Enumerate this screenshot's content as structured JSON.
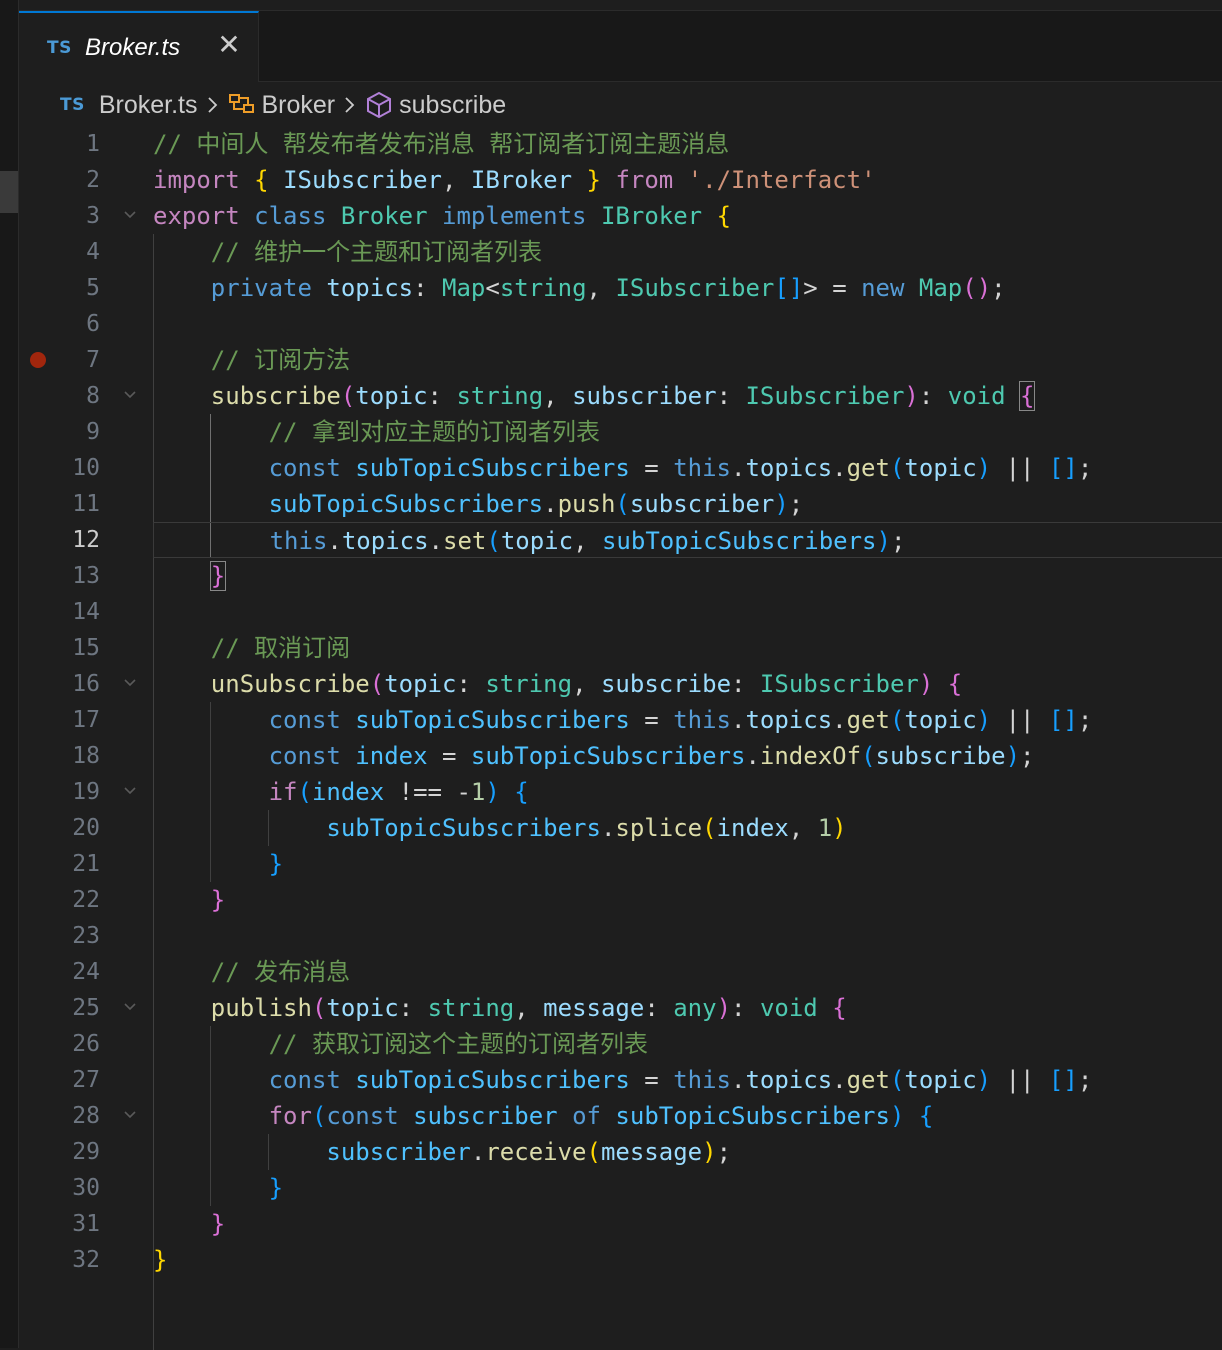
{
  "tab": {
    "lang_badge": "TS",
    "filename": "Broker.ts",
    "close_glyph": "✕"
  },
  "breadcrumb": {
    "lang_badge": "TS",
    "file": "Broker.ts",
    "class_name": "Broker",
    "method_name": "subscribe",
    "class_icon": "symbol-class-icon",
    "method_icon": "symbol-method-icon"
  },
  "editor": {
    "current_line": 12,
    "breakpoint_line": 7,
    "lines": [
      [
        [
          "cm",
          "// 中间人 帮发布者发布消息 帮订阅者订阅主题消息"
        ]
      ],
      [
        [
          "kc",
          "import"
        ],
        [
          "pu",
          " "
        ],
        [
          "b1",
          "{"
        ],
        [
          "pu",
          " "
        ],
        [
          "va",
          "ISubscriber"
        ],
        [
          "pu",
          ", "
        ],
        [
          "va",
          "IBroker"
        ],
        [
          "pu",
          " "
        ],
        [
          "b1",
          "}"
        ],
        [
          "pu",
          " "
        ],
        [
          "kc",
          "from"
        ],
        [
          "pu",
          " "
        ],
        [
          "st",
          "'./Interfact'"
        ]
      ],
      [
        [
          "kc",
          "export"
        ],
        [
          "pu",
          " "
        ],
        [
          "kw",
          "class"
        ],
        [
          "pu",
          " "
        ],
        [
          "ty",
          "Broker"
        ],
        [
          "pu",
          " "
        ],
        [
          "kw",
          "implements"
        ],
        [
          "pu",
          " "
        ],
        [
          "ty",
          "IBroker"
        ],
        [
          "pu",
          " "
        ],
        [
          "b1",
          "{"
        ]
      ],
      [
        [
          "pu",
          "    "
        ],
        [
          "cm",
          "// 维护一个主题和订阅者列表"
        ]
      ],
      [
        [
          "pu",
          "    "
        ],
        [
          "kw",
          "private"
        ],
        [
          "pu",
          " "
        ],
        [
          "va",
          "topics"
        ],
        [
          "pu",
          ": "
        ],
        [
          "ty",
          "Map"
        ],
        [
          "pu",
          "<"
        ],
        [
          "ty",
          "string"
        ],
        [
          "pu",
          ", "
        ],
        [
          "ty",
          "ISubscriber"
        ],
        [
          "b3",
          "[]"
        ],
        [
          "pu",
          "> = "
        ],
        [
          "kw",
          "new"
        ],
        [
          "pu",
          " "
        ],
        [
          "ty",
          "Map"
        ],
        [
          "b2",
          "()"
        ],
        [
          "pu",
          ";"
        ]
      ],
      [
        [
          "pu",
          ""
        ]
      ],
      [
        [
          "pu",
          "    "
        ],
        [
          "cm",
          "// 订阅方法"
        ]
      ],
      [
        [
          "pu",
          "    "
        ],
        [
          "fn",
          "subscribe"
        ],
        [
          "b2",
          "("
        ],
        [
          "va",
          "topic"
        ],
        [
          "pu",
          ": "
        ],
        [
          "ty",
          "string"
        ],
        [
          "pu",
          ", "
        ],
        [
          "va",
          "subscriber"
        ],
        [
          "pu",
          ": "
        ],
        [
          "ty",
          "ISubscriber"
        ],
        [
          "b2",
          ")"
        ],
        [
          "pu",
          ": "
        ],
        [
          "ty",
          "void"
        ],
        [
          "pu",
          " "
        ],
        [
          "b2m",
          "{"
        ]
      ],
      [
        [
          "pu",
          "        "
        ],
        [
          "cm",
          "// 拿到对应主题的订阅者列表"
        ]
      ],
      [
        [
          "pu",
          "        "
        ],
        [
          "kw",
          "const"
        ],
        [
          "pu",
          " "
        ],
        [
          "co",
          "subTopicSubscribers"
        ],
        [
          "pu",
          " = "
        ],
        [
          "kw",
          "this"
        ],
        [
          "pu",
          "."
        ],
        [
          "va",
          "topics"
        ],
        [
          "pu",
          "."
        ],
        [
          "fn",
          "get"
        ],
        [
          "b3",
          "("
        ],
        [
          "va",
          "topic"
        ],
        [
          "b3",
          ")"
        ],
        [
          "pu",
          " || "
        ],
        [
          "b3",
          "[]"
        ],
        [
          "pu",
          ";"
        ]
      ],
      [
        [
          "pu",
          "        "
        ],
        [
          "co",
          "subTopicSubscribers"
        ],
        [
          "pu",
          "."
        ],
        [
          "fn",
          "push"
        ],
        [
          "b3",
          "("
        ],
        [
          "va",
          "subscriber"
        ],
        [
          "b3",
          ")"
        ],
        [
          "pu",
          ";"
        ]
      ],
      [
        [
          "pu",
          "        "
        ],
        [
          "kw",
          "this"
        ],
        [
          "pu",
          "."
        ],
        [
          "va",
          "topics"
        ],
        [
          "pu",
          "."
        ],
        [
          "fn",
          "set"
        ],
        [
          "b3",
          "("
        ],
        [
          "va",
          "topic"
        ],
        [
          "pu",
          ", "
        ],
        [
          "co",
          "subTopicSubscribers"
        ],
        [
          "b3",
          ")"
        ],
        [
          "pu",
          ";"
        ]
      ],
      [
        [
          "pu",
          "    "
        ],
        [
          "b2m",
          "}"
        ]
      ],
      [
        [
          "pu",
          ""
        ]
      ],
      [
        [
          "pu",
          "    "
        ],
        [
          "cm",
          "// 取消订阅"
        ]
      ],
      [
        [
          "pu",
          "    "
        ],
        [
          "fn",
          "unSubscribe"
        ],
        [
          "b2",
          "("
        ],
        [
          "va",
          "topic"
        ],
        [
          "pu",
          ": "
        ],
        [
          "ty",
          "string"
        ],
        [
          "pu",
          ", "
        ],
        [
          "va",
          "subscribe"
        ],
        [
          "pu",
          ": "
        ],
        [
          "ty",
          "ISubscriber"
        ],
        [
          "b2",
          ")"
        ],
        [
          "pu",
          " "
        ],
        [
          "b2",
          "{"
        ]
      ],
      [
        [
          "pu",
          "        "
        ],
        [
          "kw",
          "const"
        ],
        [
          "pu",
          " "
        ],
        [
          "co",
          "subTopicSubscribers"
        ],
        [
          "pu",
          " = "
        ],
        [
          "kw",
          "this"
        ],
        [
          "pu",
          "."
        ],
        [
          "va",
          "topics"
        ],
        [
          "pu",
          "."
        ],
        [
          "fn",
          "get"
        ],
        [
          "b3",
          "("
        ],
        [
          "va",
          "topic"
        ],
        [
          "b3",
          ")"
        ],
        [
          "pu",
          " || "
        ],
        [
          "b3",
          "[]"
        ],
        [
          "pu",
          ";"
        ]
      ],
      [
        [
          "pu",
          "        "
        ],
        [
          "kw",
          "const"
        ],
        [
          "pu",
          " "
        ],
        [
          "co",
          "index"
        ],
        [
          "pu",
          " = "
        ],
        [
          "co",
          "subTopicSubscribers"
        ],
        [
          "pu",
          "."
        ],
        [
          "fn",
          "indexOf"
        ],
        [
          "b3",
          "("
        ],
        [
          "va",
          "subscribe"
        ],
        [
          "b3",
          ")"
        ],
        [
          "pu",
          ";"
        ]
      ],
      [
        [
          "pu",
          "        "
        ],
        [
          "kc",
          "if"
        ],
        [
          "b3",
          "("
        ],
        [
          "co",
          "index"
        ],
        [
          "pu",
          " !== "
        ],
        [
          "pu",
          "-"
        ],
        [
          "nu",
          "1"
        ],
        [
          "b3",
          ")"
        ],
        [
          "pu",
          " "
        ],
        [
          "b3",
          "{"
        ]
      ],
      [
        [
          "pu",
          "            "
        ],
        [
          "co",
          "subTopicSubscribers"
        ],
        [
          "pu",
          "."
        ],
        [
          "fn",
          "splice"
        ],
        [
          "b1",
          "("
        ],
        [
          "va",
          "index"
        ],
        [
          "pu",
          ", "
        ],
        [
          "nu",
          "1"
        ],
        [
          "b1",
          ")"
        ]
      ],
      [
        [
          "pu",
          "        "
        ],
        [
          "b3",
          "}"
        ]
      ],
      [
        [
          "pu",
          "    "
        ],
        [
          "b2",
          "}"
        ]
      ],
      [
        [
          "pu",
          ""
        ]
      ],
      [
        [
          "pu",
          "    "
        ],
        [
          "cm",
          "// 发布消息"
        ]
      ],
      [
        [
          "pu",
          "    "
        ],
        [
          "fn",
          "publish"
        ],
        [
          "b2",
          "("
        ],
        [
          "va",
          "topic"
        ],
        [
          "pu",
          ": "
        ],
        [
          "ty",
          "string"
        ],
        [
          "pu",
          ", "
        ],
        [
          "va",
          "message"
        ],
        [
          "pu",
          ": "
        ],
        [
          "ty",
          "any"
        ],
        [
          "b2",
          ")"
        ],
        [
          "pu",
          ": "
        ],
        [
          "ty",
          "void"
        ],
        [
          "pu",
          " "
        ],
        [
          "b2",
          "{"
        ]
      ],
      [
        [
          "pu",
          "        "
        ],
        [
          "cm",
          "// 获取订阅这个主题的订阅者列表"
        ]
      ],
      [
        [
          "pu",
          "        "
        ],
        [
          "kw",
          "const"
        ],
        [
          "pu",
          " "
        ],
        [
          "co",
          "subTopicSubscribers"
        ],
        [
          "pu",
          " = "
        ],
        [
          "kw",
          "this"
        ],
        [
          "pu",
          "."
        ],
        [
          "va",
          "topics"
        ],
        [
          "pu",
          "."
        ],
        [
          "fn",
          "get"
        ],
        [
          "b3",
          "("
        ],
        [
          "va",
          "topic"
        ],
        [
          "b3",
          ")"
        ],
        [
          "pu",
          " || "
        ],
        [
          "b3",
          "[]"
        ],
        [
          "pu",
          ";"
        ]
      ],
      [
        [
          "pu",
          "        "
        ],
        [
          "kc",
          "for"
        ],
        [
          "b3",
          "("
        ],
        [
          "kw",
          "const"
        ],
        [
          "pu",
          " "
        ],
        [
          "co",
          "subscriber"
        ],
        [
          "pu",
          " "
        ],
        [
          "kw",
          "of"
        ],
        [
          "pu",
          " "
        ],
        [
          "co",
          "subTopicSubscribers"
        ],
        [
          "b3",
          ")"
        ],
        [
          "pu",
          " "
        ],
        [
          "b3",
          "{"
        ]
      ],
      [
        [
          "pu",
          "            "
        ],
        [
          "co",
          "subscriber"
        ],
        [
          "pu",
          "."
        ],
        [
          "fn",
          "receive"
        ],
        [
          "b1",
          "("
        ],
        [
          "va",
          "message"
        ],
        [
          "b1",
          ")"
        ],
        [
          "pu",
          ";"
        ]
      ],
      [
        [
          "pu",
          "        "
        ],
        [
          "b3",
          "}"
        ]
      ],
      [
        [
          "pu",
          "    "
        ],
        [
          "b2",
          "}"
        ]
      ],
      [
        [
          "b1",
          "}"
        ]
      ]
    ]
  }
}
